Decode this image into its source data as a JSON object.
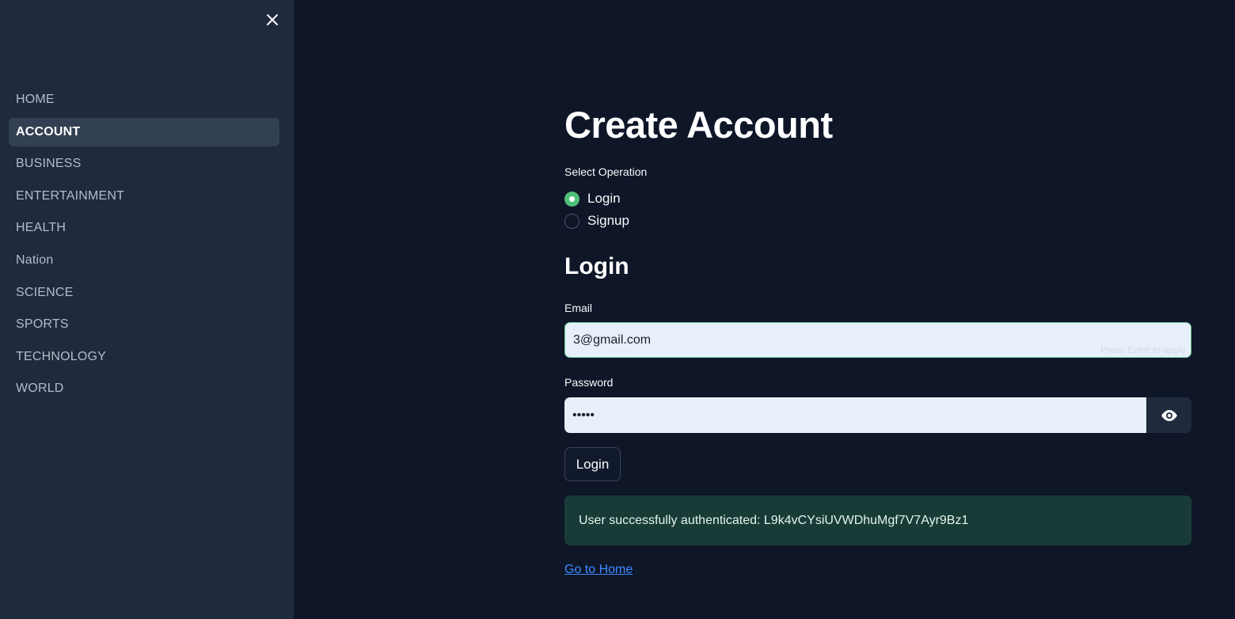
{
  "sidebar": {
    "close_icon": "close-icon",
    "items": [
      {
        "label": "HOME",
        "active": false
      },
      {
        "label": "ACCOUNT",
        "active": true
      },
      {
        "label": "BUSINESS",
        "active": false
      },
      {
        "label": "ENTERTAINMENT",
        "active": false
      },
      {
        "label": "HEALTH",
        "active": false
      },
      {
        "label": "Nation",
        "active": false
      },
      {
        "label": "SCIENCE",
        "active": false
      },
      {
        "label": "SPORTS",
        "active": false
      },
      {
        "label": "TECHNOLOGY",
        "active": false
      },
      {
        "label": "WORLD",
        "active": false
      }
    ]
  },
  "main": {
    "title": "Create Account",
    "operation": {
      "label": "Select Operation",
      "options": [
        "Login",
        "Signup"
      ],
      "selected": "Login"
    },
    "form": {
      "heading": "Login",
      "email_label": "Email",
      "email_value": "3@gmail.com",
      "email_hint": "Press Enter to apply",
      "password_label": "Password",
      "password_value": "•••••",
      "show_password_icon": "eye-icon",
      "submit_label": "Login"
    },
    "alert": {
      "text": "User successfully authenticated: L9k4vCYsiUVWDhuMgf7V7Ayr9Bz1"
    },
    "home_link": "Go to Home"
  },
  "colors": {
    "background": "#0e1628",
    "sidebar": "#1f2a3c",
    "radio_accent": "#4fc07a",
    "success_bg": "#183b38",
    "link": "#3b8cff"
  }
}
